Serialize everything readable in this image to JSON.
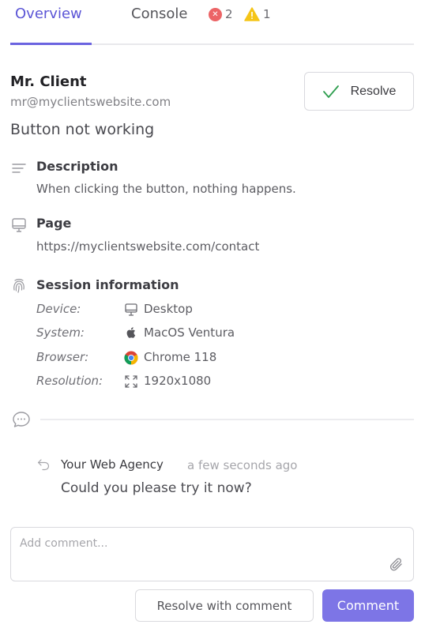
{
  "tabs": [
    {
      "label": "Overview",
      "active": true
    },
    {
      "label": "Console",
      "active": false
    }
  ],
  "console_badges": {
    "errors": "2",
    "warnings": "1"
  },
  "client": {
    "name": "Mr. Client",
    "email": "mr@myclientswebsite.com"
  },
  "resolve_label": "Resolve",
  "issue_title": "Button not working",
  "description": {
    "title": "Description",
    "text": "When clicking the button, nothing happens."
  },
  "page": {
    "title": "Page",
    "url": "https://myclientswebsite.com/contact"
  },
  "session": {
    "title": "Session information",
    "rows": [
      {
        "label": "Device:",
        "icon": "desktop-icon",
        "value": "Desktop"
      },
      {
        "label": "System:",
        "icon": "apple-icon",
        "value": "MacOS Ventura"
      },
      {
        "label": "Browser:",
        "icon": "chrome-icon",
        "value": "Chrome 118"
      },
      {
        "label": "Resolution:",
        "icon": "expand-icon",
        "value": "1920x1080"
      }
    ]
  },
  "reply": {
    "author": "Your Web Agency",
    "time": "a few seconds ago",
    "body": "Could you please try it now?"
  },
  "comment": {
    "placeholder": "Add comment...",
    "value": ""
  },
  "actions": {
    "resolve_with_comment": "Resolve with comment",
    "comment": "Comment"
  },
  "colors": {
    "accent": "#6b64e0",
    "comment_button": "#7d75e6",
    "error": "#ec6466",
    "warning": "#f5c518",
    "check": "#2e9e4f"
  }
}
